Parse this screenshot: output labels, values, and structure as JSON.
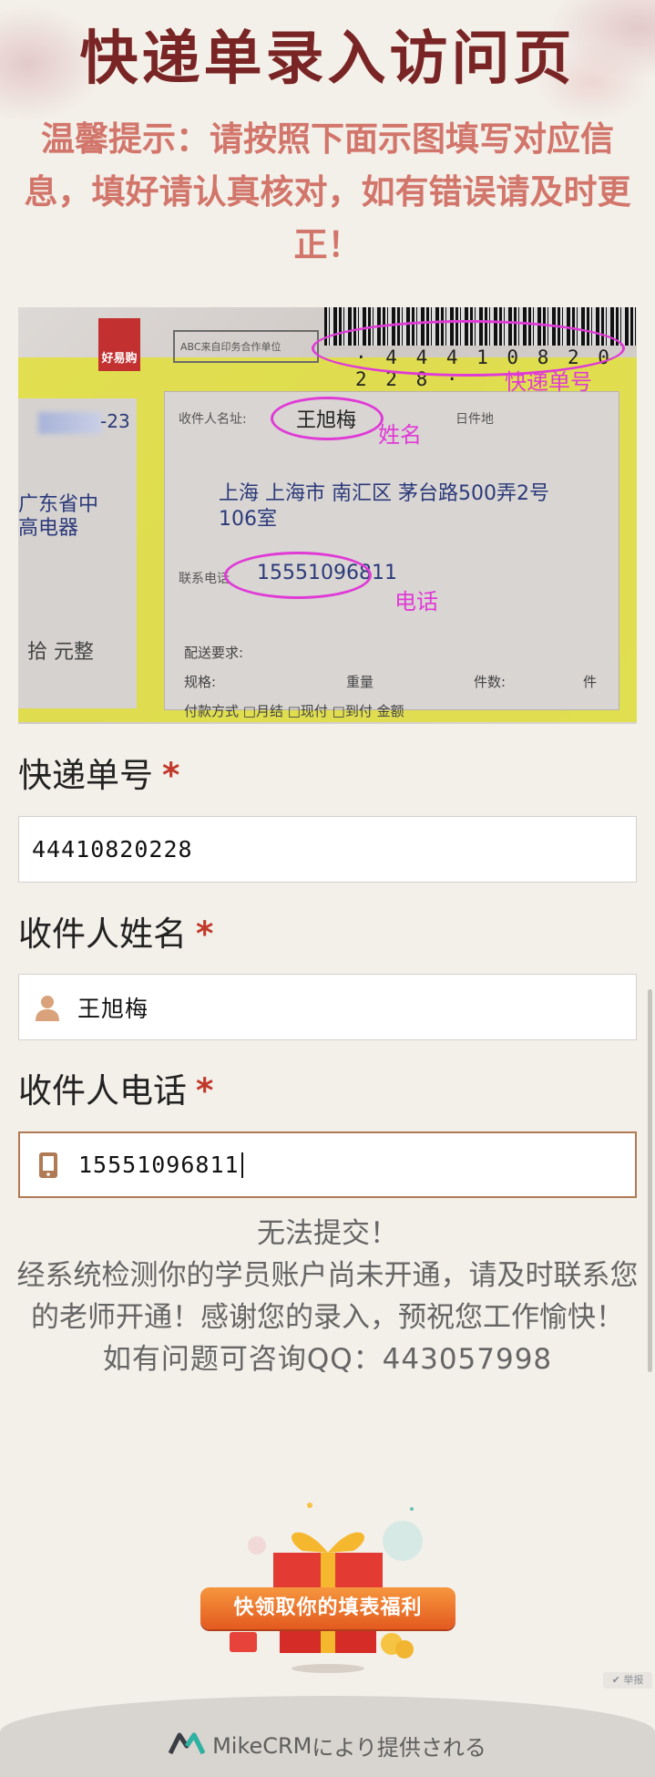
{
  "page_title": "快递单录入访问页",
  "tip": "温馨提示：请按照下面示图填写对应信息，填好请认真核对，如有错误请及时更正！",
  "example_image": {
    "tracking_number": "· 4 4 4 1 0 8 2 0 2 2 8 ·",
    "annotations": {
      "tracking": "快递单号",
      "name": "姓名",
      "phone": "电话"
    },
    "logo_text": "好易购",
    "abc_text": "ABC来自印务合作单位",
    "recipient_label": "收件人名址:",
    "recipient_name": "王旭梅",
    "date_label": "日件地",
    "address_line1": "上海  上海市  南汇区  茅台路500弄2号",
    "address_line2": "106室",
    "phone_label": "联系电话",
    "phone_number": "15551096811",
    "left_snippet": "-23",
    "left_text1": "广东省中",
    "left_text2": "高电器",
    "left_text3": "拾  元整",
    "delivery_label": "配送要求:",
    "spec_label": "规格:",
    "weight_label": "重量",
    "count_label": "件数:",
    "count_unit": "件",
    "pay_line": "付款方式  □月结   □现付   □到付   金额"
  },
  "form": {
    "tracking": {
      "label": "快递单号",
      "required_mark": "*",
      "value": "44410820228"
    },
    "recipient_name": {
      "label": "收件人姓名",
      "required_mark": "*",
      "value": "王旭梅",
      "icon": "person-icon"
    },
    "recipient_phone": {
      "label": "收件人电话",
      "required_mark": "*",
      "value": "15551096811",
      "icon": "phone-icon"
    }
  },
  "message": {
    "line1": "无法提交！",
    "line2": "经系统检测你的学员账户尚未开通，请及时联系您的老师开通！感谢您的录入，预祝您工作愉快！",
    "line3": "如有问题可咨询QQ：443057998"
  },
  "promo": {
    "button_label": "快领取你的填表福利"
  },
  "report_label": "✔ 举报",
  "footer": {
    "brand": "MikeCRM",
    "text": "により提供される"
  },
  "colors": {
    "title": "#7a2525",
    "tip": "#d2756a",
    "annotation": "#e03ad6",
    "required": "#c0392b",
    "active_border": "#b07a55"
  }
}
